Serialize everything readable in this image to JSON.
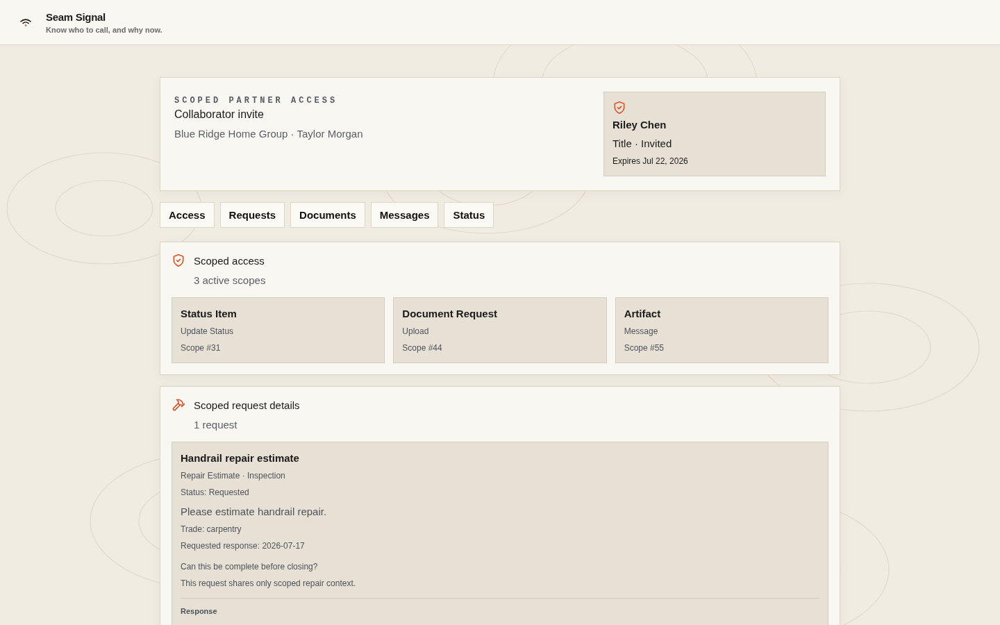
{
  "app": {
    "name": "Seam Signal",
    "tagline": "Know who to call, and why now."
  },
  "invite": {
    "eyebrow": "SCOPED PARTNER ACCESS",
    "title": "Collaborator invite",
    "subtitle": "Blue Ridge Home Group · Taylor Morgan",
    "partner": {
      "name": "Riley Chen",
      "role": "Title · Invited",
      "expires": "Expires Jul 22, 2026"
    }
  },
  "tabs": [
    {
      "label": "Access"
    },
    {
      "label": "Requests"
    },
    {
      "label": "Documents"
    },
    {
      "label": "Messages"
    },
    {
      "label": "Status"
    }
  ],
  "scoped_access": {
    "title": "Scoped access",
    "count": "3 active scopes",
    "scopes": [
      {
        "title": "Status Item",
        "action": "Update Status",
        "scope": "Scope #31"
      },
      {
        "title": "Document Request",
        "action": "Upload",
        "scope": "Scope #44"
      },
      {
        "title": "Artifact",
        "action": "Message",
        "scope": "Scope #55"
      }
    ]
  },
  "request_details": {
    "title": "Scoped request details",
    "count": "1 request",
    "requests": [
      {
        "title": "Handrail repair estimate",
        "type": "Repair Estimate · Inspection",
        "status": "Status: Requested",
        "message": "Please estimate handrail repair.",
        "trade": "Trade: carpentry",
        "due": "Requested response: 2026-07-17",
        "question": "Can this be complete before closing?",
        "note": "This request shares only scoped repair context.",
        "response_label": "Response"
      }
    ]
  }
}
